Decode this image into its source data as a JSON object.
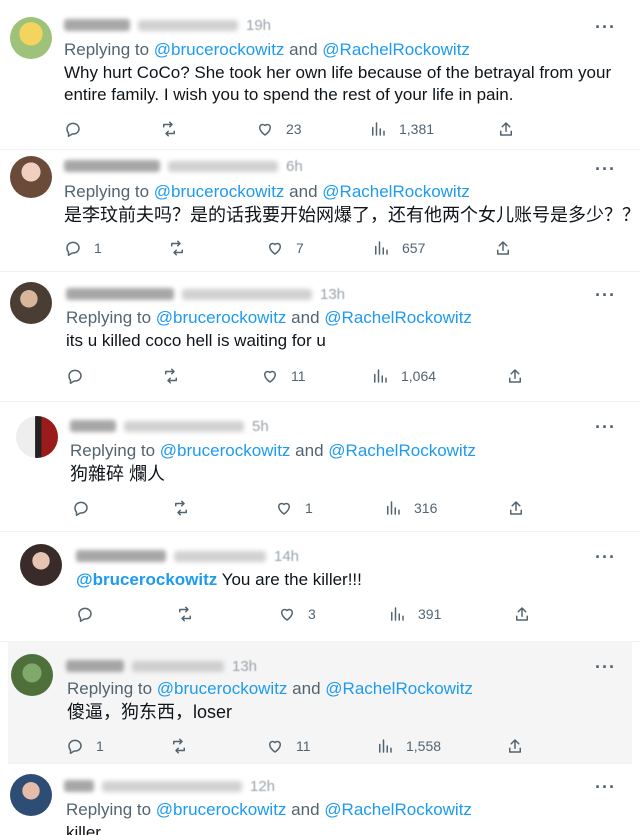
{
  "reply_prefix": "Replying to",
  "reply_and": "and",
  "tweets": [
    {
      "time": "19h",
      "reply_users": [
        "@brucerockowitz",
        "@RachelRockowitz"
      ],
      "text_lines": [
        "Why hurt CoCo? She took her own life because of the betrayal from your",
        "entire family. I wish you to spend the rest of your life in pain."
      ],
      "replies": "",
      "retweets": "",
      "likes": "23",
      "views": "1,381"
    },
    {
      "time": "6h",
      "reply_users": [
        "@brucerockowitz",
        "@RachelRockowitz"
      ],
      "text_lines": [
        "是李玟前夫吗？是的话我要开始网爆了，还有他两个女儿账号是多少？？"
      ],
      "replies": "1",
      "retweets": "",
      "likes": "7",
      "views": "657"
    },
    {
      "time": "13h",
      "reply_users": [
        "@brucerockowitz",
        "@RachelRockowitz"
      ],
      "text_lines": [
        "its u killed coco hell is waiting for u"
      ],
      "replies": "",
      "retweets": "",
      "likes": "11",
      "views": "1,064"
    },
    {
      "time": "5h",
      "reply_users": [
        "@brucerockowitz",
        "@RachelRockowitz"
      ],
      "text_lines": [
        "狗雜碎 爛人"
      ],
      "replies": "",
      "retweets": "",
      "likes": "1",
      "views": "316"
    },
    {
      "time": "14h",
      "mention": "@brucerockowitz",
      "text_lines": [
        "You are the killer!!!"
      ],
      "replies": "",
      "retweets": "",
      "likes": "3",
      "views": "391"
    },
    {
      "time": "13h",
      "reply_users": [
        "@brucerockowitz",
        "@RachelRockowitz"
      ],
      "text_lines": [
        "傻逼，狗东西，loser"
      ],
      "replies": "1",
      "retweets": "",
      "likes": "11",
      "views": "1,558"
    },
    {
      "time": "12h",
      "reply_users": [
        "@brucerockowitz",
        "@RachelRockowitz"
      ],
      "text_lines": [
        "killer"
      ],
      "replies": "",
      "retweets": "",
      "likes": "",
      "views": ""
    }
  ]
}
